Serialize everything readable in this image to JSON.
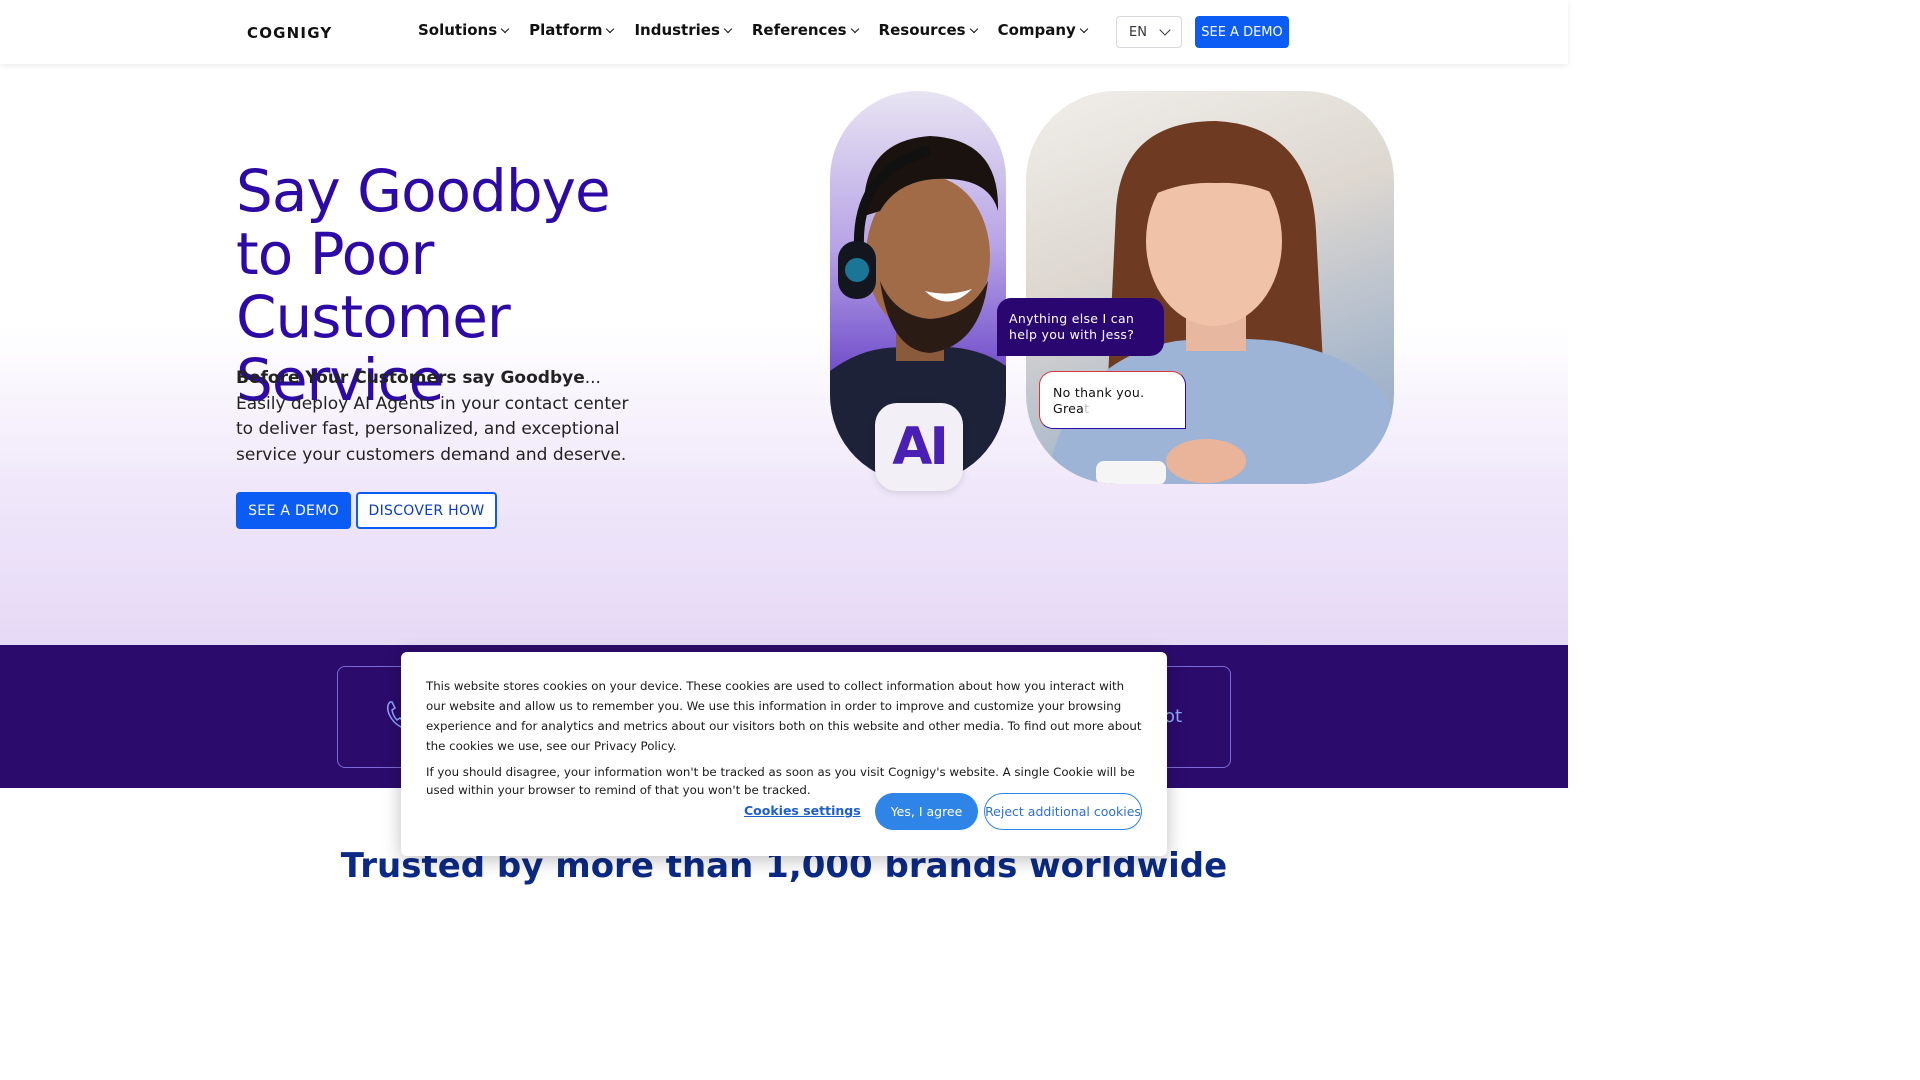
{
  "nav": {
    "logo": "COGNIGY",
    "items": [
      {
        "label": "Solutions"
      },
      {
        "label": "Platform"
      },
      {
        "label": "Industries"
      },
      {
        "label": "References"
      },
      {
        "label": "Resources"
      },
      {
        "label": "Company"
      }
    ],
    "language": "EN",
    "demo_label": "SEE A DEMO"
  },
  "hero": {
    "title": "Say Goodbye to Poor Customer Service",
    "subtitle_bold": "Before Your Customers say Goodbye",
    "subtitle_rest": "... Easily deploy AI Agents in your contact center to deliver fast, personalized, and exceptional service your customers demand and deserve.",
    "primary_cta": "SEE A DEMO",
    "secondary_cta": "DISCOVER HOW",
    "ai_badge": "AI",
    "bubble_ai": "Anything else I can help you with Jess?",
    "bubble_user": "No thank you.",
    "bubble_user_typing": "Great",
    "bubble_user_typing_fade": "t"
  },
  "band": {
    "right_text": "ot"
  },
  "trusted": {
    "title": "Trusted by more than 1,000 brands worldwide"
  },
  "cookie": {
    "text1": "This website stores cookies on your device. These cookies are used to collect information about how you interact with our website and allow us to remember you. We use this information in order to improve and customize your browsing experience and for analytics and metrics about our visitors both on this website and other media. To find out more about the cookies we use, see our Privacy Policy.",
    "text2": "If you should disagree, your information won't be tracked as soon as you visit Cognigy's website. A single Cookie will be used within your browser to remind of that you won't be tracked.",
    "settings_label": "Cookies settings",
    "agree_label": "Yes, I agree",
    "reject_label": "Reject additional cookies"
  },
  "colors": {
    "brand_blue": "#0a5cf5",
    "hero_purple": "#2d0aa5",
    "band_purple": "#2b0b6c"
  }
}
